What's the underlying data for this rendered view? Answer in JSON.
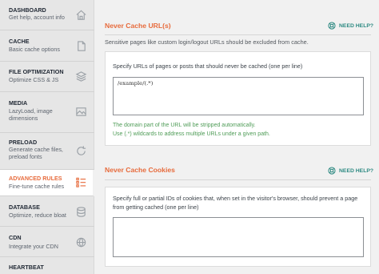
{
  "sidebar": {
    "items": [
      {
        "title": "DASHBOARD",
        "subtitle": "Get help, account info",
        "icon": "home-icon"
      },
      {
        "title": "CACHE",
        "subtitle": "Basic cache options",
        "icon": "file-icon"
      },
      {
        "title": "FILE OPTIMIZATION",
        "subtitle": "Optimize CSS & JS",
        "icon": "layers-icon"
      },
      {
        "title": "MEDIA",
        "subtitle": "LazyLoad, image dimensions",
        "icon": "image-icon"
      },
      {
        "title": "PRELOAD",
        "subtitle": "Generate cache files, preload fonts",
        "icon": "refresh-icon"
      },
      {
        "title": "ADVANCED RULES",
        "subtitle": "Fine-tune cache rules",
        "icon": "list-icon",
        "active": true
      },
      {
        "title": "DATABASE",
        "subtitle": "Optimize, reduce bloat",
        "icon": "database-icon"
      },
      {
        "title": "CDN",
        "subtitle": "Integrate your CDN",
        "icon": "cdn-icon"
      },
      {
        "title": "HEARTBEAT",
        "subtitle": "",
        "icon": "heart-icon"
      }
    ]
  },
  "sections": [
    {
      "title": "Never Cache URL(s)",
      "help_label": "NEED HELP?",
      "description": "Sensitive pages like custom login/logout URLs should be excluded from cache.",
      "field_label": "Specify URLs of pages or posts that should never be cached (one per line)",
      "textarea_value": "/example/(.*)",
      "notes": [
        "The domain part of the URL will be stripped automatically.",
        "Use (.*) wildcards to address multiple URLs under a given path."
      ]
    },
    {
      "title": "Never Cache Cookies",
      "help_label": "NEED HELP?",
      "field_label": "Specify full or partial IDs of cookies that, when set in the visitor's browser, should prevent a page from getting cached (one per line)",
      "textarea_value": ""
    }
  ],
  "colors": {
    "accent": "#e76b3c",
    "help": "#2d8a82",
    "note": "#4f9c57"
  }
}
